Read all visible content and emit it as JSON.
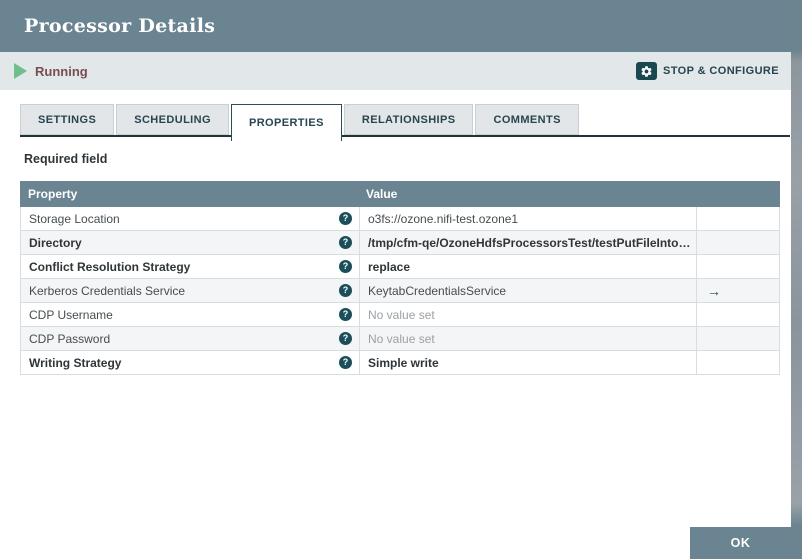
{
  "window": {
    "title": "Processor Details"
  },
  "status_bar": {
    "state": "Running",
    "action": "STOP & CONFIGURE"
  },
  "tabs": [
    {
      "label": "SETTINGS",
      "active": false
    },
    {
      "label": "SCHEDULING",
      "active": false
    },
    {
      "label": "PROPERTIES",
      "active": true
    },
    {
      "label": "RELATIONSHIPS",
      "active": false
    },
    {
      "label": "COMMENTS",
      "active": false
    }
  ],
  "properties_panel": {
    "required_field_label": "Required field",
    "table": {
      "headers": {
        "property": "Property",
        "value": "Value"
      },
      "rows": [
        {
          "property": "Storage Location",
          "value": "o3fs://ozone.nifi-test.ozone1",
          "required": false,
          "value_set": true,
          "has_help": true,
          "has_goto": false
        },
        {
          "property": "Directory",
          "value": "/tmp/cfm-qe/OzoneHdfsProcessorsTest/testPutFileInto…",
          "required": true,
          "value_set": true,
          "has_help": true,
          "has_goto": false
        },
        {
          "property": "Conflict Resolution Strategy",
          "value": "replace",
          "required": true,
          "value_set": true,
          "has_help": true,
          "has_goto": false
        },
        {
          "property": "Kerberos Credentials Service",
          "value": "KeytabCredentialsService",
          "required": false,
          "value_set": true,
          "has_help": true,
          "has_goto": true
        },
        {
          "property": "CDP Username",
          "value": "No value set",
          "required": false,
          "value_set": false,
          "has_help": true,
          "has_goto": false
        },
        {
          "property": "CDP Password",
          "value": "No value set",
          "required": false,
          "value_set": false,
          "has_help": true,
          "has_goto": false
        },
        {
          "property": "Writing Strategy",
          "value": "Simple write",
          "required": true,
          "value_set": true,
          "has_help": true,
          "has_goto": false
        }
      ]
    }
  },
  "footer": {
    "ok_label": "OK"
  },
  "icons": {
    "help": "?",
    "goto_arrow": "→"
  },
  "colors": {
    "header_bg": "#6A8591",
    "status_bg": "#E2E7E9",
    "running_text": "#7A4E50",
    "running_play": "#6FBE8E",
    "teal_dark": "#1B4E59",
    "tab_text": "#26454E",
    "row_alt_bg": "#F3F5F6",
    "unset_text": "#9AA2A7"
  }
}
